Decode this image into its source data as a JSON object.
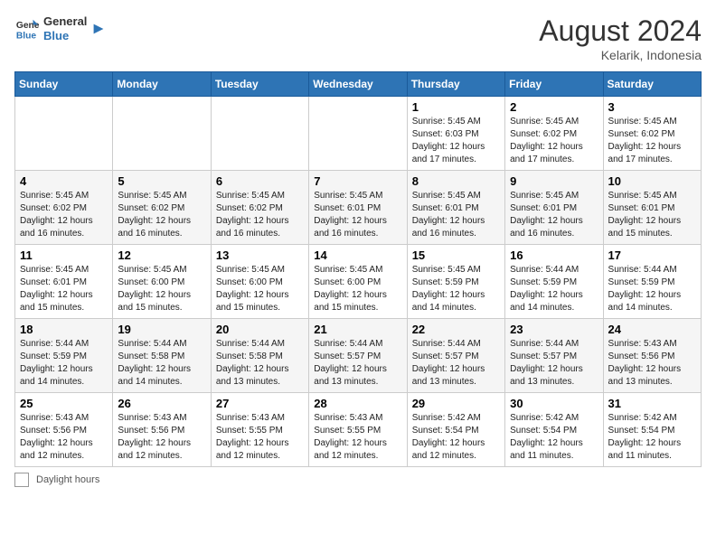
{
  "header": {
    "logo_text_general": "General",
    "logo_text_blue": "Blue",
    "month_year": "August 2024",
    "location": "Kelarik, Indonesia"
  },
  "days_of_week": [
    "Sunday",
    "Monday",
    "Tuesday",
    "Wednesday",
    "Thursday",
    "Friday",
    "Saturday"
  ],
  "weeks": [
    [
      {
        "day": "",
        "info": ""
      },
      {
        "day": "",
        "info": ""
      },
      {
        "day": "",
        "info": ""
      },
      {
        "day": "",
        "info": ""
      },
      {
        "day": "1",
        "info": "Sunrise: 5:45 AM\nSunset: 6:03 PM\nDaylight: 12 hours and 17 minutes."
      },
      {
        "day": "2",
        "info": "Sunrise: 5:45 AM\nSunset: 6:02 PM\nDaylight: 12 hours and 17 minutes."
      },
      {
        "day": "3",
        "info": "Sunrise: 5:45 AM\nSunset: 6:02 PM\nDaylight: 12 hours and 17 minutes."
      }
    ],
    [
      {
        "day": "4",
        "info": "Sunrise: 5:45 AM\nSunset: 6:02 PM\nDaylight: 12 hours and 16 minutes."
      },
      {
        "day": "5",
        "info": "Sunrise: 5:45 AM\nSunset: 6:02 PM\nDaylight: 12 hours and 16 minutes."
      },
      {
        "day": "6",
        "info": "Sunrise: 5:45 AM\nSunset: 6:02 PM\nDaylight: 12 hours and 16 minutes."
      },
      {
        "day": "7",
        "info": "Sunrise: 5:45 AM\nSunset: 6:01 PM\nDaylight: 12 hours and 16 minutes."
      },
      {
        "day": "8",
        "info": "Sunrise: 5:45 AM\nSunset: 6:01 PM\nDaylight: 12 hours and 16 minutes."
      },
      {
        "day": "9",
        "info": "Sunrise: 5:45 AM\nSunset: 6:01 PM\nDaylight: 12 hours and 16 minutes."
      },
      {
        "day": "10",
        "info": "Sunrise: 5:45 AM\nSunset: 6:01 PM\nDaylight: 12 hours and 15 minutes."
      }
    ],
    [
      {
        "day": "11",
        "info": "Sunrise: 5:45 AM\nSunset: 6:01 PM\nDaylight: 12 hours and 15 minutes."
      },
      {
        "day": "12",
        "info": "Sunrise: 5:45 AM\nSunset: 6:00 PM\nDaylight: 12 hours and 15 minutes."
      },
      {
        "day": "13",
        "info": "Sunrise: 5:45 AM\nSunset: 6:00 PM\nDaylight: 12 hours and 15 minutes."
      },
      {
        "day": "14",
        "info": "Sunrise: 5:45 AM\nSunset: 6:00 PM\nDaylight: 12 hours and 15 minutes."
      },
      {
        "day": "15",
        "info": "Sunrise: 5:45 AM\nSunset: 5:59 PM\nDaylight: 12 hours and 14 minutes."
      },
      {
        "day": "16",
        "info": "Sunrise: 5:44 AM\nSunset: 5:59 PM\nDaylight: 12 hours and 14 minutes."
      },
      {
        "day": "17",
        "info": "Sunrise: 5:44 AM\nSunset: 5:59 PM\nDaylight: 12 hours and 14 minutes."
      }
    ],
    [
      {
        "day": "18",
        "info": "Sunrise: 5:44 AM\nSunset: 5:59 PM\nDaylight: 12 hours and 14 minutes."
      },
      {
        "day": "19",
        "info": "Sunrise: 5:44 AM\nSunset: 5:58 PM\nDaylight: 12 hours and 14 minutes."
      },
      {
        "day": "20",
        "info": "Sunrise: 5:44 AM\nSunset: 5:58 PM\nDaylight: 12 hours and 13 minutes."
      },
      {
        "day": "21",
        "info": "Sunrise: 5:44 AM\nSunset: 5:57 PM\nDaylight: 12 hours and 13 minutes."
      },
      {
        "day": "22",
        "info": "Sunrise: 5:44 AM\nSunset: 5:57 PM\nDaylight: 12 hours and 13 minutes."
      },
      {
        "day": "23",
        "info": "Sunrise: 5:44 AM\nSunset: 5:57 PM\nDaylight: 12 hours and 13 minutes."
      },
      {
        "day": "24",
        "info": "Sunrise: 5:43 AM\nSunset: 5:56 PM\nDaylight: 12 hours and 13 minutes."
      }
    ],
    [
      {
        "day": "25",
        "info": "Sunrise: 5:43 AM\nSunset: 5:56 PM\nDaylight: 12 hours and 12 minutes."
      },
      {
        "day": "26",
        "info": "Sunrise: 5:43 AM\nSunset: 5:56 PM\nDaylight: 12 hours and 12 minutes."
      },
      {
        "day": "27",
        "info": "Sunrise: 5:43 AM\nSunset: 5:55 PM\nDaylight: 12 hours and 12 minutes."
      },
      {
        "day": "28",
        "info": "Sunrise: 5:43 AM\nSunset: 5:55 PM\nDaylight: 12 hours and 12 minutes."
      },
      {
        "day": "29",
        "info": "Sunrise: 5:42 AM\nSunset: 5:54 PM\nDaylight: 12 hours and 12 minutes."
      },
      {
        "day": "30",
        "info": "Sunrise: 5:42 AM\nSunset: 5:54 PM\nDaylight: 12 hours and 11 minutes."
      },
      {
        "day": "31",
        "info": "Sunrise: 5:42 AM\nSunset: 5:54 PM\nDaylight: 12 hours and 11 minutes."
      }
    ]
  ],
  "footer": {
    "daylight_label": "Daylight hours"
  }
}
